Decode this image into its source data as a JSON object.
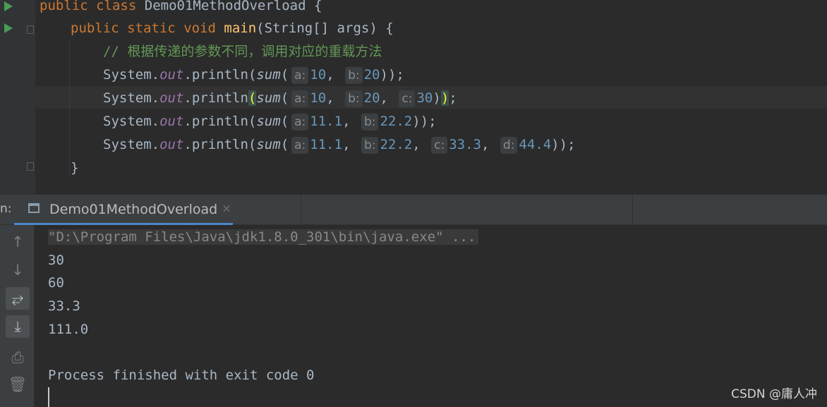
{
  "editor": {
    "line1": {
      "kw1": "public",
      "kw2": "class",
      "name": "Demo01MethodOverload",
      "brace": "{"
    },
    "line2": {
      "kw1": "public",
      "kw2": "static",
      "kw3": "void",
      "method": "main",
      "params": "(String[] args) {"
    },
    "comment": "// 根据传递的参数不同，调用对应的重载方法",
    "calls": [
      {
        "prefix": "System.",
        "field": "out",
        "mid": ".println(",
        "fn": "sum",
        "args": [
          {
            "hint": "a:",
            "value": "10"
          },
          {
            "hint": "b:",
            "value": "20"
          }
        ],
        "suffix": "));"
      },
      {
        "prefix": "System.",
        "field": "out",
        "mid": ".println",
        "fn": "sum",
        "args": [
          {
            "hint": "a:",
            "value": "10"
          },
          {
            "hint": "b:",
            "value": "20"
          },
          {
            "hint": "c:",
            "value": "30"
          }
        ],
        "suffix": ";"
      },
      {
        "prefix": "System.",
        "field": "out",
        "mid": ".println(",
        "fn": "sum",
        "args": [
          {
            "hint": "a:",
            "value": "11.1"
          },
          {
            "hint": "b:",
            "value": "22.2"
          }
        ],
        "suffix": "));"
      },
      {
        "prefix": "System.",
        "field": "out",
        "mid": ".println(",
        "fn": "sum",
        "args": [
          {
            "hint": "a:",
            "value": "11.1"
          },
          {
            "hint": "b:",
            "value": "22.2"
          },
          {
            "hint": "c:",
            "value": "33.3"
          },
          {
            "hint": "d:",
            "value": "44.4"
          }
        ],
        "suffix": "));"
      }
    ],
    "closing": "}"
  },
  "run_panel": {
    "label": "n:",
    "tab_title": "Demo01MethodOverload",
    "tab_close": "×",
    "toolbar_icons": [
      "arrow-up-icon",
      "arrow-down-icon",
      "soft-wrap-icon",
      "scroll-to-end-icon",
      "print-icon",
      "trash-icon"
    ]
  },
  "console": {
    "command": "\"D:\\Program Files\\Java\\jdk1.8.0_301\\bin\\java.exe\" ...",
    "outputs": [
      "30",
      "60",
      "33.3",
      "111.0"
    ],
    "exit_message": "Process finished with exit code 0"
  },
  "watermark": "CSDN @庸人冲",
  "colors": {
    "keyword": "#cc7832",
    "method": "#ffc66d",
    "number": "#6897bb",
    "field": "#9876aa",
    "comment": "#629755",
    "text": "#a9b7c6",
    "background": "#2b2b2b"
  }
}
